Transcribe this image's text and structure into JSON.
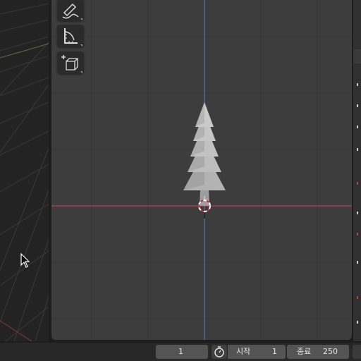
{
  "timeline": {
    "current_frame": "1",
    "start_label": "시작",
    "start_value": "1",
    "end_label": "종료",
    "end_value": "250"
  },
  "toolbar": {
    "tools": [
      {
        "id": "annotate",
        "icon": "pencil-icon"
      },
      {
        "id": "measure",
        "icon": "ruler-icon"
      },
      {
        "id": "add-cube",
        "icon": "add-cube-icon"
      }
    ]
  },
  "viewport": {
    "object": "tree-mesh",
    "colors": {
      "background": "#3d3d3d",
      "x_axis": "#b8434f",
      "y_axis": "#4f79b5",
      "mesh": "#b8b8b8"
    }
  }
}
